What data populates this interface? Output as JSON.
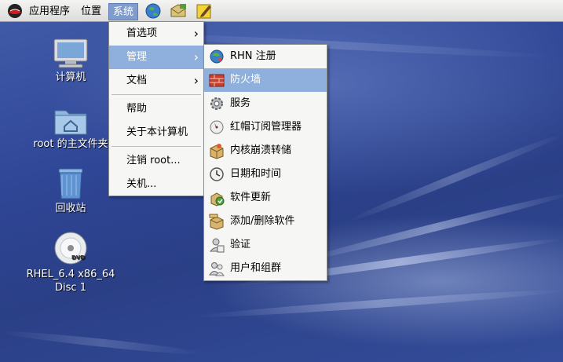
{
  "top_panel": {
    "menus": {
      "applications": "应用程序",
      "places": "位置",
      "system": "系统"
    }
  },
  "desktop": {
    "icons": [
      {
        "label": "计算机"
      },
      {
        "label": "root 的主文件夹"
      },
      {
        "label": "回收站"
      },
      {
        "label": "RHEL_6.4 x86_64 Disc 1",
        "disc_badge": "DVD"
      }
    ]
  },
  "system_menu": {
    "items": [
      {
        "label": "首选项"
      },
      {
        "label": "管理"
      },
      {
        "label": "文档"
      },
      {
        "label": "帮助"
      },
      {
        "label": "关于本计算机"
      },
      {
        "label": "注销 root..."
      },
      {
        "label": "关机..."
      }
    ]
  },
  "admin_submenu": {
    "items": [
      {
        "label": "RHN 注册",
        "icon": "rhn-register-icon"
      },
      {
        "label": "防火墙",
        "icon": "firewall-icon"
      },
      {
        "label": "服务",
        "icon": "services-gear-icon"
      },
      {
        "label": "红帽订阅管理器",
        "icon": "subscription-manager-icon"
      },
      {
        "label": "内核崩溃转储",
        "icon": "kdump-box-icon"
      },
      {
        "label": "日期和时间",
        "icon": "clock-icon"
      },
      {
        "label": "软件更新",
        "icon": "software-update-icon"
      },
      {
        "label": "添加/删除软件",
        "icon": "add-remove-software-icon"
      },
      {
        "label": "验证",
        "icon": "authentication-icon"
      },
      {
        "label": "用户和组群",
        "icon": "users-groups-icon"
      }
    ]
  },
  "colors": {
    "menu_highlight": "#8fb0dc",
    "panel_active": "#7f9ccd",
    "desktop_blue": "#2a3f86"
  }
}
